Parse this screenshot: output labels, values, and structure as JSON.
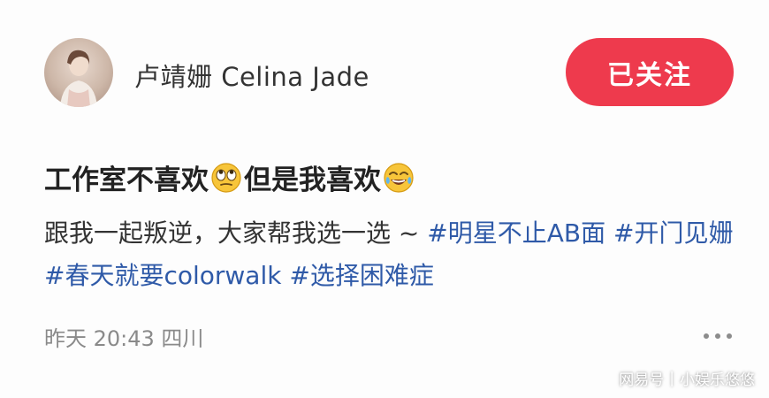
{
  "user": {
    "name": "卢靖姗 Celina Jade"
  },
  "follow_button": {
    "label": "已关注",
    "color": "#ee3a4d"
  },
  "post": {
    "title_part1": "工作室不喜欢",
    "title_emoji1": "eye-roll-emoji",
    "title_part2": "但是我喜欢",
    "title_emoji2": "tears-of-joy-emoji",
    "body_text": "跟我一起叛逆，大家帮我选一选 ~ ",
    "hashtags": [
      "#明星不止AB面",
      "#开门见姗",
      "#春天就要colorwalk",
      "#选择困难症"
    ],
    "hashtag_color": "#2f5aa8"
  },
  "meta": {
    "timestamp": "昨天 20:43 四川"
  },
  "more_menu": {
    "icon": "more-dots-icon"
  },
  "watermark": {
    "source": "网易号",
    "separator": "|",
    "author": "小娱乐悠悠"
  }
}
